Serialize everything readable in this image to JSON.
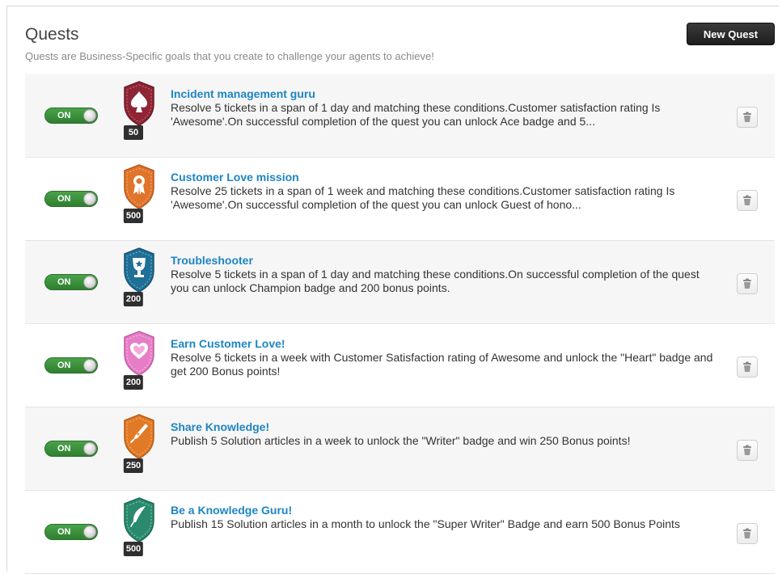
{
  "header": {
    "title": "Quests",
    "subtitle": "Quests are Business-Specific goals that you create to challenge your agents to achieve!",
    "new_quest_label": "New Quest"
  },
  "quests": [
    {
      "toggle": "ON",
      "points": "50",
      "badge_icon": "spade-icon",
      "badge_color": "#8e2535",
      "title": "Incident management guru",
      "description": "Resolve 5 tickets in a span of 1 day and matching these conditions.Customer satisfaction rating Is 'Awesome'.On successful completion of the quest you can unlock Ace badge and 5..."
    },
    {
      "toggle": "ON",
      "points": "500",
      "badge_icon": "award-ribbon-icon",
      "badge_color": "#e0742a",
      "title": "Customer Love mission",
      "description": "Resolve 25 tickets in a span of 1 week and matching these conditions.Customer satisfaction rating Is 'Awesome'.On successful completion of the quest you can unlock Guest of hono..."
    },
    {
      "toggle": "ON",
      "points": "200",
      "badge_icon": "trophy-icon",
      "badge_color": "#1f6f96",
      "title": "Troubleshooter",
      "description": "Resolve 5 tickets in a span of 1 day and matching these conditions.On successful completion of the quest you can unlock Champion badge and 200 bonus points."
    },
    {
      "toggle": "ON",
      "points": "200",
      "badge_icon": "heart-icon",
      "badge_color": "#e57ec6",
      "title": "Earn Customer Love!",
      "description": "Resolve 5 tickets in a week with Customer Satisfaction rating of Awesome and unlock the \"Heart\" badge and get 200 Bonus points!"
    },
    {
      "toggle": "ON",
      "points": "250",
      "badge_icon": "pen-nib-icon",
      "badge_color": "#e07a26",
      "title": "Share Knowledge!",
      "description": "Publish 5 Solution articles in a week to unlock the \"Writer\" badge and win 250 Bonus points!"
    },
    {
      "toggle": "ON",
      "points": "500",
      "badge_icon": "feather-icon",
      "badge_color": "#2b8a6e",
      "title": "Be a Knowledge Guru!",
      "description": "Publish 15 Solution articles in a month to unlock the \"Super Writer\" Badge and earn 500 Bonus Points"
    }
  ]
}
